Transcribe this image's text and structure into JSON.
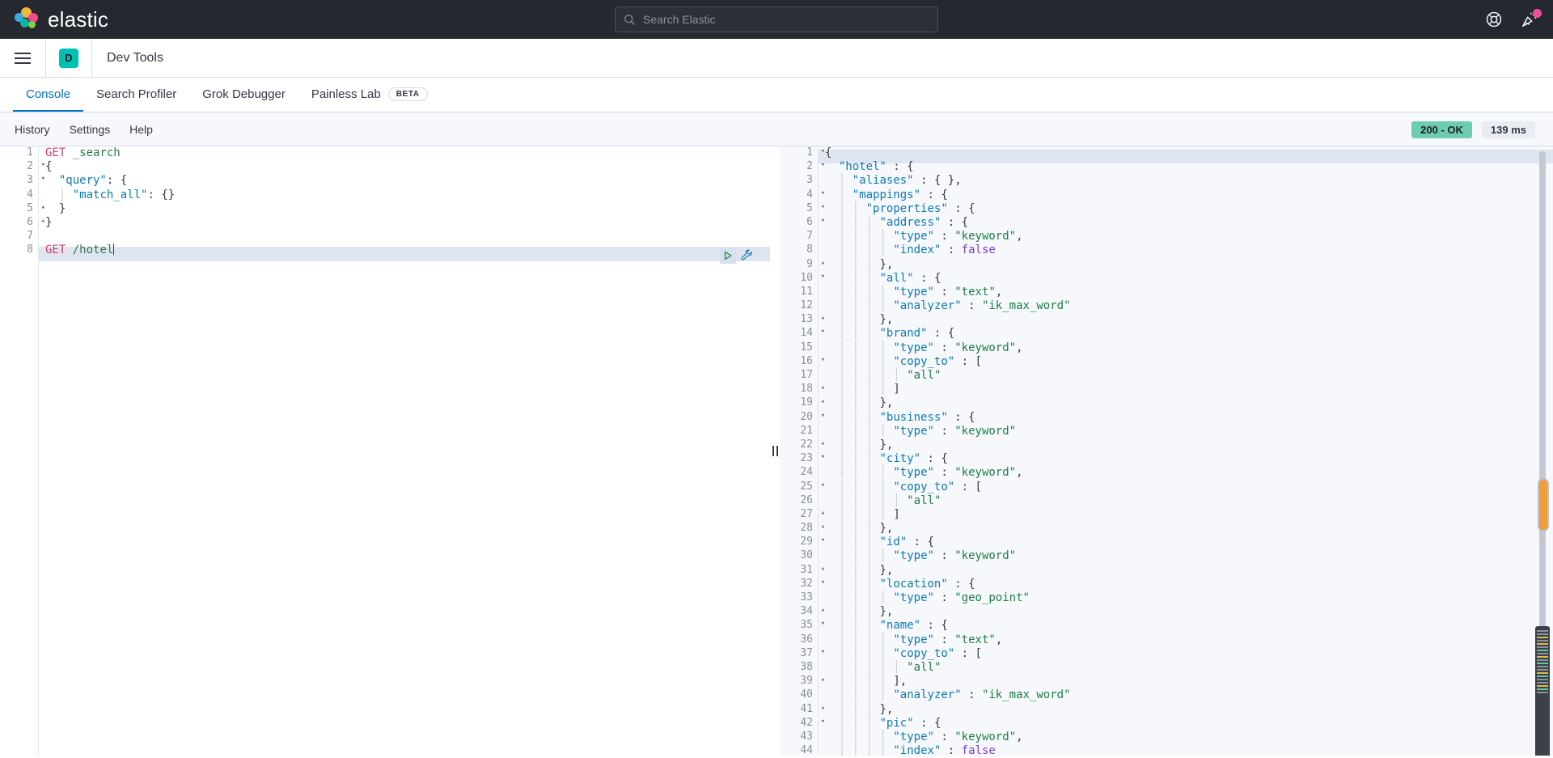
{
  "header": {
    "brand_name": "elastic",
    "search_placeholder": "Search Elastic",
    "search_value": "",
    "icons": {
      "help": "lifebuoy-icon",
      "whats_new": "party-popper-icon"
    }
  },
  "breadcrumb": {
    "app_initial": "D",
    "title": "Dev Tools"
  },
  "tabs": [
    {
      "label": "Console",
      "active": true,
      "badge": ""
    },
    {
      "label": "Search Profiler",
      "active": false,
      "badge": ""
    },
    {
      "label": "Grok Debugger",
      "active": false,
      "badge": ""
    },
    {
      "label": "Painless Lab",
      "active": false,
      "badge": "BETA"
    }
  ],
  "console_toolbar": {
    "links": [
      "History",
      "Settings",
      "Help"
    ],
    "status": "200 - OK",
    "time": "139 ms",
    "status_color": "#6dccb1"
  },
  "request_editor": {
    "name": "console-request-editor",
    "lines": [
      {
        "n": 1,
        "fold": "",
        "text": "GET _search"
      },
      {
        "n": 2,
        "fold": "▾",
        "text": "{"
      },
      {
        "n": 3,
        "fold": "▾",
        "text": "  \"query\": {"
      },
      {
        "n": 4,
        "fold": "",
        "text": "    \"match_all\": {}"
      },
      {
        "n": 5,
        "fold": "▴",
        "text": "  }"
      },
      {
        "n": 6,
        "fold": "▴",
        "text": "}"
      },
      {
        "n": 7,
        "fold": "",
        "text": ""
      },
      {
        "n": 8,
        "fold": "",
        "text": "GET /hotel"
      }
    ],
    "active_line": 8,
    "actions": {
      "run": "play-icon",
      "wrench": "wrench-icon"
    }
  },
  "response_editor": {
    "name": "console-response-editor",
    "lines": [
      {
        "n": 1,
        "fold": "▾",
        "text": "{"
      },
      {
        "n": 2,
        "fold": "▾",
        "text": "  \"hotel\" : {"
      },
      {
        "n": 3,
        "fold": "",
        "text": "    \"aliases\" : { },"
      },
      {
        "n": 4,
        "fold": "▾",
        "text": "    \"mappings\" : {"
      },
      {
        "n": 5,
        "fold": "▾",
        "text": "      \"properties\" : {"
      },
      {
        "n": 6,
        "fold": "▾",
        "text": "        \"address\" : {"
      },
      {
        "n": 7,
        "fold": "",
        "text": "          \"type\" : \"keyword\","
      },
      {
        "n": 8,
        "fold": "",
        "text": "          \"index\" : false"
      },
      {
        "n": 9,
        "fold": "▴",
        "text": "        },"
      },
      {
        "n": 10,
        "fold": "▾",
        "text": "        \"all\" : {"
      },
      {
        "n": 11,
        "fold": "",
        "text": "          \"type\" : \"text\","
      },
      {
        "n": 12,
        "fold": "",
        "text": "          \"analyzer\" : \"ik_max_word\""
      },
      {
        "n": 13,
        "fold": "▴",
        "text": "        },"
      },
      {
        "n": 14,
        "fold": "▾",
        "text": "        \"brand\" : {"
      },
      {
        "n": 15,
        "fold": "",
        "text": "          \"type\" : \"keyword\","
      },
      {
        "n": 16,
        "fold": "▾",
        "text": "          \"copy_to\" : ["
      },
      {
        "n": 17,
        "fold": "",
        "text": "            \"all\""
      },
      {
        "n": 18,
        "fold": "▴",
        "text": "          ]"
      },
      {
        "n": 19,
        "fold": "▴",
        "text": "        },"
      },
      {
        "n": 20,
        "fold": "▾",
        "text": "        \"business\" : {"
      },
      {
        "n": 21,
        "fold": "",
        "text": "          \"type\" : \"keyword\""
      },
      {
        "n": 22,
        "fold": "▴",
        "text": "        },"
      },
      {
        "n": 23,
        "fold": "▾",
        "text": "        \"city\" : {"
      },
      {
        "n": 24,
        "fold": "",
        "text": "          \"type\" : \"keyword\","
      },
      {
        "n": 25,
        "fold": "▾",
        "text": "          \"copy_to\" : ["
      },
      {
        "n": 26,
        "fold": "",
        "text": "            \"all\""
      },
      {
        "n": 27,
        "fold": "▴",
        "text": "          ]"
      },
      {
        "n": 28,
        "fold": "▴",
        "text": "        },"
      },
      {
        "n": 29,
        "fold": "▾",
        "text": "        \"id\" : {"
      },
      {
        "n": 30,
        "fold": "",
        "text": "          \"type\" : \"keyword\""
      },
      {
        "n": 31,
        "fold": "▴",
        "text": "        },"
      },
      {
        "n": 32,
        "fold": "▾",
        "text": "        \"location\" : {"
      },
      {
        "n": 33,
        "fold": "",
        "text": "          \"type\" : \"geo_point\""
      },
      {
        "n": 34,
        "fold": "▴",
        "text": "        },"
      },
      {
        "n": 35,
        "fold": "▾",
        "text": "        \"name\" : {"
      },
      {
        "n": 36,
        "fold": "",
        "text": "          \"type\" : \"text\","
      },
      {
        "n": 37,
        "fold": "▾",
        "text": "          \"copy_to\" : ["
      },
      {
        "n": 38,
        "fold": "",
        "text": "            \"all\""
      },
      {
        "n": 39,
        "fold": "▴",
        "text": "          ],"
      },
      {
        "n": 40,
        "fold": "",
        "text": "          \"analyzer\" : \"ik_max_word\""
      },
      {
        "n": 41,
        "fold": "▴",
        "text": "        },"
      },
      {
        "n": 42,
        "fold": "▾",
        "text": "        \"pic\" : {"
      },
      {
        "n": 43,
        "fold": "",
        "text": "          \"type\" : \"keyword\","
      },
      {
        "n": 44,
        "fold": "",
        "text": "          \"index\" : false"
      }
    ],
    "active_line": 1
  }
}
